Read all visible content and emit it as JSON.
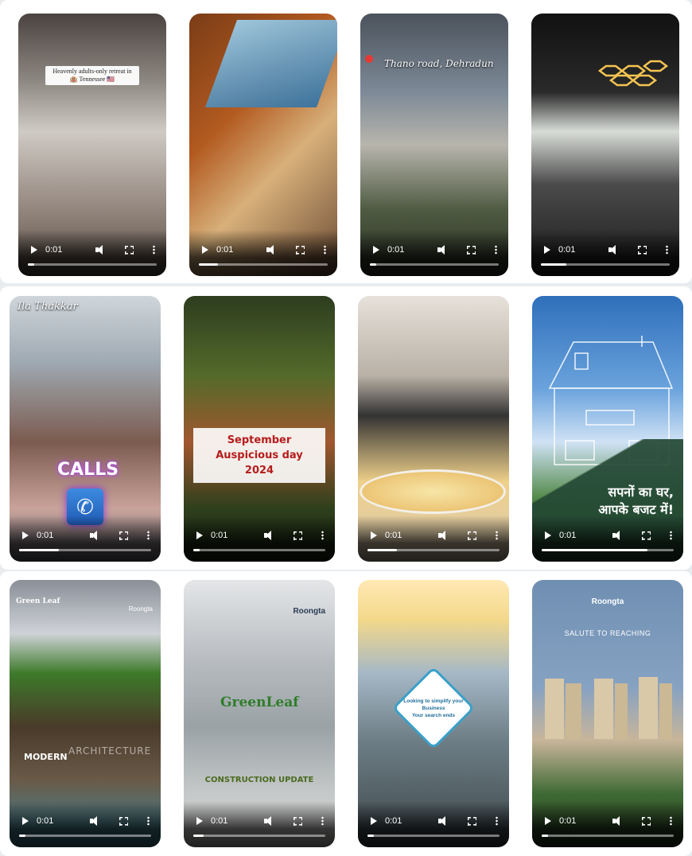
{
  "videos": [
    {
      "time": "0:01",
      "progress": 0.05,
      "caption": "Heavenly adults-only retreat in\n🏨 Tennessee 🇺🇸"
    },
    {
      "time": "0:01",
      "progress": 0.15
    },
    {
      "time": "0:01",
      "progress": 0.05,
      "caption": "Thano road, Dehradun"
    },
    {
      "time": "0:01",
      "progress": 0.2
    },
    {
      "time": "0:01",
      "progress": 0.3,
      "caption_top": "Ila Thakkar",
      "caption": "CALLS"
    },
    {
      "time": "0:01",
      "progress": 0.05,
      "caption": "September\nAuspicious day\n2024"
    },
    {
      "time": "0:01",
      "progress": 0.22
    },
    {
      "time": "0:01",
      "progress": 0.8,
      "caption": "सपनों का घर,\nआपके बजट में!"
    },
    {
      "time": "0:01",
      "progress": 0.05,
      "caption": "MODERN",
      "caption2": "ARCHITECTURE",
      "logo": "Green Leaf",
      "logo2": "Roongta"
    },
    {
      "time": "0:01",
      "progress": 0.08,
      "logo": "Roongta",
      "logo2": "GreenLeaf",
      "caption": "CONSTRUCTION UPDATE"
    },
    {
      "time": "0:01",
      "progress": 0.05,
      "caption": "Looking to simplify your Business\nYour search ends"
    },
    {
      "time": "0:01",
      "progress": 0.05,
      "logo": "Roongta",
      "caption": "SALUTE TO REACHING"
    }
  ],
  "icons": {
    "play": "play-icon",
    "volume": "volume-icon",
    "fullscreen": "fullscreen-icon",
    "more": "more-options-icon",
    "phone": "phone-icon"
  }
}
